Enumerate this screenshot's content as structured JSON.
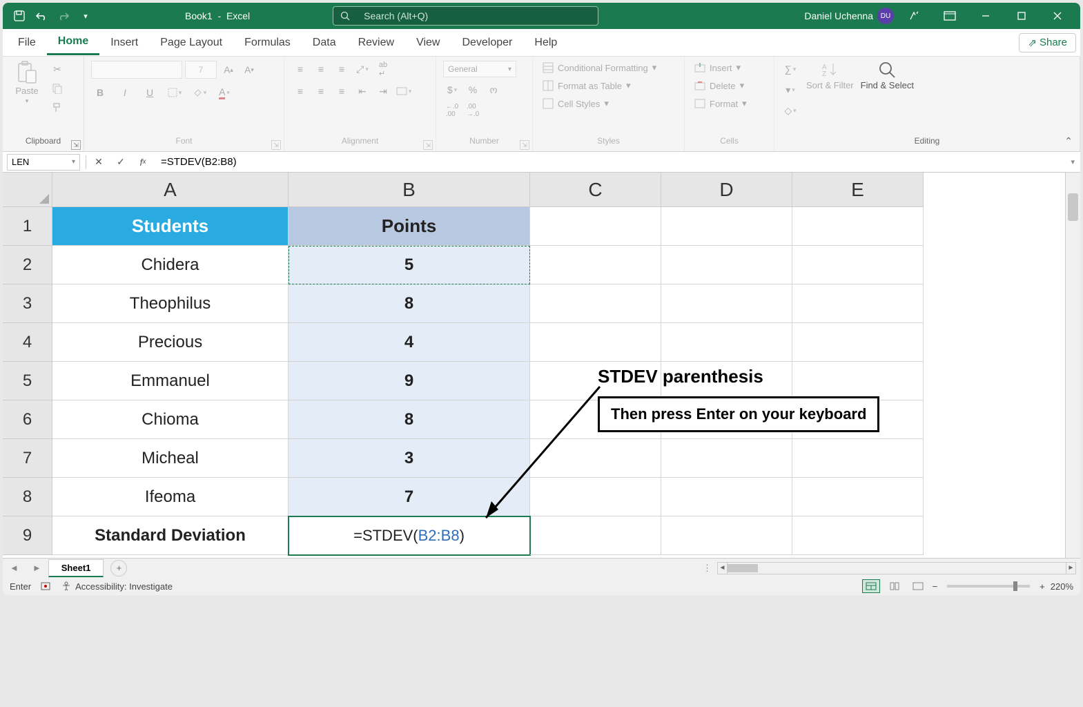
{
  "titlebar": {
    "title_left": "Book1",
    "title_right": "Excel",
    "search_placeholder": "Search (Alt+Q)",
    "user_name": "Daniel Uchenna",
    "user_initials": "DU"
  },
  "tabs": {
    "items": [
      "File",
      "Home",
      "Insert",
      "Page Layout",
      "Formulas",
      "Data",
      "Review",
      "View",
      "Developer",
      "Help"
    ],
    "active": "Home",
    "share": "Share"
  },
  "ribbon": {
    "clipboard": {
      "paste": "Paste",
      "label": "Clipboard"
    },
    "font": {
      "size": "7",
      "label": "Font"
    },
    "alignment": {
      "label": "Alignment"
    },
    "number": {
      "format": "General",
      "label": "Number"
    },
    "styles": {
      "cond": "Conditional Formatting",
      "table": "Format as Table",
      "cell": "Cell Styles",
      "label": "Styles"
    },
    "cells": {
      "insert": "Insert",
      "delete": "Delete",
      "format": "Format",
      "label": "Cells"
    },
    "editing": {
      "sort": "Sort & Filter",
      "find": "Find & Select",
      "label": "Editing"
    }
  },
  "formula_bar": {
    "name_box": "LEN",
    "formula": "=STDEV(B2:B8)"
  },
  "grid": {
    "columns": [
      "A",
      "B",
      "C",
      "D",
      "E"
    ],
    "rows": [
      "1",
      "2",
      "3",
      "4",
      "5",
      "6",
      "7",
      "8",
      "9"
    ],
    "headerA": "Students",
    "headerB": "Points",
    "data": [
      {
        "a": "Chidera",
        "b": "5"
      },
      {
        "a": "Theophilus",
        "b": "8"
      },
      {
        "a": "Precious",
        "b": "4"
      },
      {
        "a": "Emmanuel",
        "b": "9"
      },
      {
        "a": "Chioma",
        "b": "8"
      },
      {
        "a": "Micheal",
        "b": "3"
      },
      {
        "a": "Ifeoma",
        "b": "7"
      }
    ],
    "footerA": "Standard Deviation",
    "footerB_pre": "=STDEV(",
    "footerB_range": "B2:B8",
    "footerB_post": ")"
  },
  "annotation": {
    "title": "STDEV parenthesis",
    "box": "Then press Enter on your keyboard"
  },
  "sheet": {
    "name": "Sheet1"
  },
  "status": {
    "mode": "Enter",
    "accessibility": "Accessibility: Investigate",
    "zoom": "220%"
  }
}
